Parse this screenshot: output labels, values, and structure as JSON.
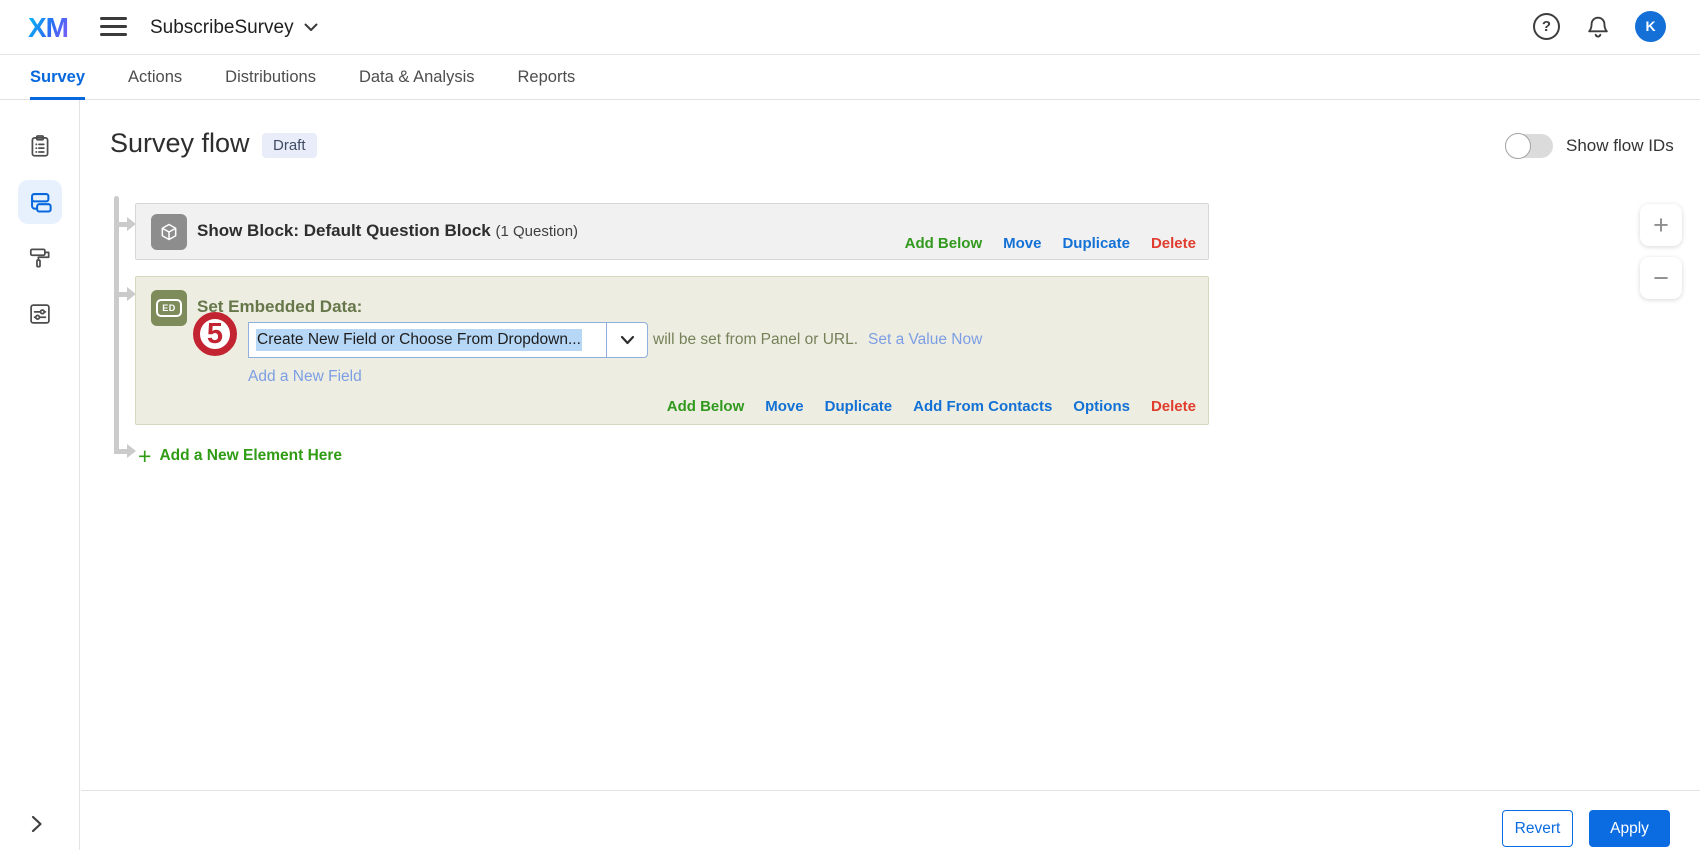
{
  "colors": {
    "accent_blue": "#0768dd",
    "link_blue": "#1371d6",
    "light_link_blue": "#7d9de4",
    "green": "#31991d",
    "red": "#e03d2e",
    "olive_text": "#67774a",
    "embedded_block_bg": "#edeee1",
    "show_block_bg": "#f1f1f1",
    "annotation_red": "#c32432",
    "avatar_blue": "#1470d6",
    "selection_highlight": "#b7d7f7"
  },
  "topbar": {
    "logo": "XM",
    "survey_name": "SubscribeSurvey",
    "help_glyph": "?",
    "avatar_initial": "K"
  },
  "tabs": [
    {
      "label": "Survey"
    },
    {
      "label": "Actions"
    },
    {
      "label": "Distributions"
    },
    {
      "label": "Data & Analysis"
    },
    {
      "label": "Reports"
    }
  ],
  "page_header": {
    "title": "Survey flow",
    "status_badge": "Draft",
    "show_flow_ids_label": "Show flow IDs",
    "toggle_state": "off"
  },
  "sidebar": {
    "icons": [
      "survey-builder-clipboard",
      "survey-flow-blocks",
      "look-and-feel-roller",
      "survey-options-sliders"
    ],
    "active_item": "survey-flow-blocks"
  },
  "flow": {
    "show_block": {
      "title": "Show Block: Default Question Block",
      "meta": "(1 Question)",
      "links": [
        "Add Below",
        "Move",
        "Duplicate",
        "Delete"
      ]
    },
    "embedded_data": {
      "title": "Set Embedded Data:",
      "annotation_number": "5",
      "field_value": "Create New Field or Choose From Dropdown...",
      "hint_text": "will be set from Panel or URL.",
      "set_value_link": "Set a Value Now",
      "add_field_link": "Add a New Field",
      "links": [
        "Add Below",
        "Move",
        "Duplicate",
        "Add From Contacts",
        "Options",
        "Delete"
      ]
    },
    "add_element_plus": "+",
    "add_element_label": "Add a New Element Here"
  },
  "zoom_controls": {
    "zoom_in": "+",
    "zoom_out": "−"
  },
  "footer": {
    "revert_label": "Revert",
    "apply_label": "Apply"
  }
}
